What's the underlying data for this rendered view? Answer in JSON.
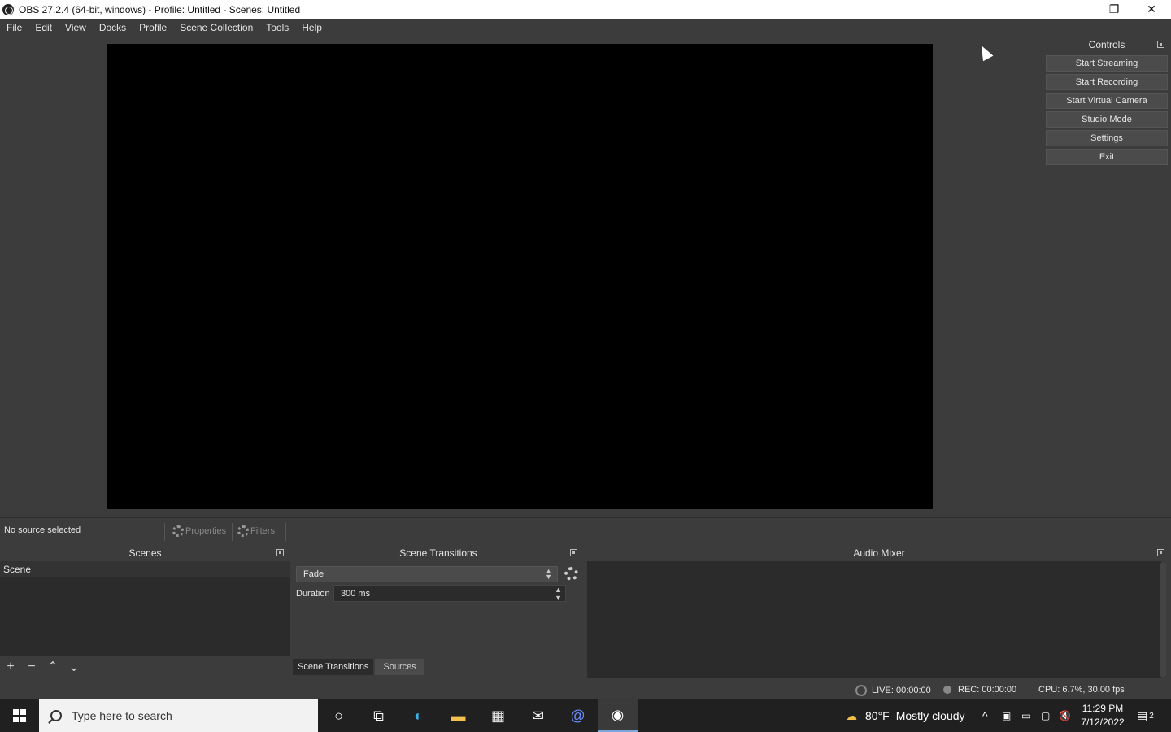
{
  "window": {
    "title": "OBS 27.2.4 (64-bit, windows) - Profile: Untitled - Scenes: Untitled",
    "minimize": "—",
    "maximize": "❐",
    "close": "✕"
  },
  "menu": [
    "File",
    "Edit",
    "View",
    "Docks",
    "Profile",
    "Scene Collection",
    "Tools",
    "Help"
  ],
  "controls": {
    "title": "Controls",
    "buttons": [
      "Start Streaming",
      "Start Recording",
      "Start Virtual Camera",
      "Studio Mode",
      "Settings",
      "Exit"
    ]
  },
  "source_toolbar": {
    "status": "No source selected",
    "properties": "Properties",
    "filters": "Filters"
  },
  "scenes": {
    "title": "Scenes",
    "items": [
      "Scene"
    ],
    "tools": [
      "+",
      "−",
      "⌃",
      "⌄"
    ]
  },
  "transitions": {
    "title": "Scene Transitions",
    "selected": "Fade",
    "duration_label": "Duration",
    "duration_value": "300 ms",
    "tabs": [
      "Scene Transitions",
      "Sources"
    ]
  },
  "mixer": {
    "title": "Audio Mixer"
  },
  "status": {
    "live": "LIVE: 00:00:00",
    "rec": "REC: 00:00:00",
    "cpu": "CPU: 6.7%, 30.00 fps"
  },
  "taskbar": {
    "search_placeholder": "Type here to search",
    "weather_temp": "80°F",
    "weather_desc": "Mostly cloudy",
    "time": "11:29 PM",
    "date": "7/12/2022",
    "notification_count": "2"
  },
  "icons": {
    "cortana": "○",
    "task_view": "⧉",
    "edge": "◐",
    "explorer": "▬",
    "store": "▦",
    "mail": "✉",
    "at_app": "@",
    "obs": "◉",
    "weather": "☁",
    "tray_up": "^",
    "speaker": "🔇",
    "notifications": "▤"
  }
}
